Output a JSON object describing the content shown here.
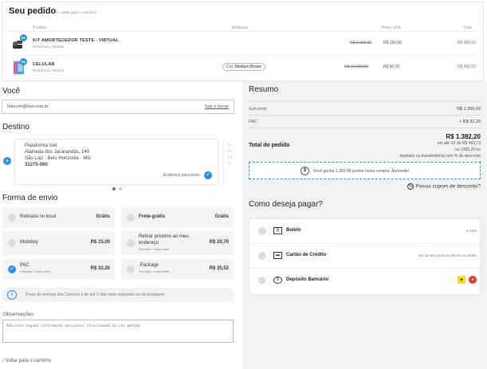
{
  "order": {
    "title": "Seu pedido",
    "back_small": "(« Voltar para o carrinho)",
    "columns": {
      "product": "Produto",
      "attributes": "Atributos",
      "unit_price": "Preço Unit.",
      "total": "Total"
    },
    "items": [
      {
        "qty": "5x",
        "name": "KIT AMORTECEDOR TESTE - VIRTUAL",
        "ref": "Referência: 554022",
        "attribute": "",
        "old_price": "R$ 2.000,00",
        "new_price": "R$ 180,00",
        "total": "R$ 900,00",
        "icon": "shock-absorber-icon"
      },
      {
        "qty": "5x",
        "name": "CELULAR",
        "ref": "Referência: 554023",
        "attribute_key": "Cor:",
        "attribute_value": "Medium Brown",
        "old_price": "R$ 10.000,00",
        "new_price": "R$ 90,00",
        "total": "R$ 450,00",
        "icon": "phone-icon"
      }
    ]
  },
  "you": {
    "title": "Você",
    "email": "falecom@iset.com.br",
    "switch_link": "Sair e trocar"
  },
  "destination": {
    "title": "Destino",
    "address": {
      "line1": "Plataforma Iset",
      "line2": "Alameda dos Jacarandás, 140",
      "line3": "São Luiz - Belo Horizonte - MG",
      "line4": "31275-060",
      "tag": "Endereço para envio"
    },
    "next_card_lines": [
      "Su",
      "Ru",
      "Sã",
      "35"
    ]
  },
  "shipping": {
    "title": "Forma de envio",
    "options": [
      {
        "label": "Retirada no local",
        "price": "Grátis",
        "selected": false
      },
      {
        "label": "Frete-grátis",
        "price": "Grátis",
        "selected": false
      },
      {
        "label": "Motoboy",
        "price": "R$ 15,00",
        "selected": false
      },
      {
        "label_line1": "Retirar próximo ao meu",
        "label_line2": "endereço",
        "sub": "Previsão: 4 dias úteis",
        "price": "R$ 20,70",
        "selected": false
      },
      {
        "label": "PAC",
        "sub": "Previsão: 9 dias úteis",
        "price": "R$ 32,20",
        "selected": true
      },
      {
        "label": ".Package",
        "sub": "Previsão: 4 dias úteis",
        "price": "R$ 35,52",
        "selected": false
      }
    ],
    "info": "Prazo de entrega dos Correios é de até 5 dias úteis seguintes ao da postagem."
  },
  "notes": {
    "label": "Observações",
    "placeholder": "Adicione alguma informação adicional relacionada ao seu pedido"
  },
  "back_link": "‹ Voltar para o carrinho",
  "summary": {
    "title": "Resumo",
    "subtotal_label": "Sub-total",
    "subtotal_value": "R$ 1.350,00",
    "shipping_label": "PAC",
    "shipping_value": "+ R$ 32,20",
    "total_label": "Total do pedido",
    "total_value": "R$ 1.382,20",
    "installments": "em até 3X de R$ 460,73",
    "or_price": "ou 1382,20 no",
    "discount_note": "depósito ou transferência com % de desconto",
    "points_text": "Você ganha 1.350,00 pontos nesta compra. Aproveite!",
    "coupon": "Possui cupom de desconto?"
  },
  "payment": {
    "title": "Como deseja pagar?",
    "methods": [
      {
        "label": "Boleto",
        "note": "à vista",
        "icon": "barcode-icon"
      },
      {
        "label": "Cartão de Crédito",
        "note": "em 3x sem juros ou até 8x no cartão",
        "icon": "credit-card-icon"
      },
      {
        "label": "Depósito Bancário",
        "note": "",
        "icon": "bank-icon"
      }
    ]
  }
}
